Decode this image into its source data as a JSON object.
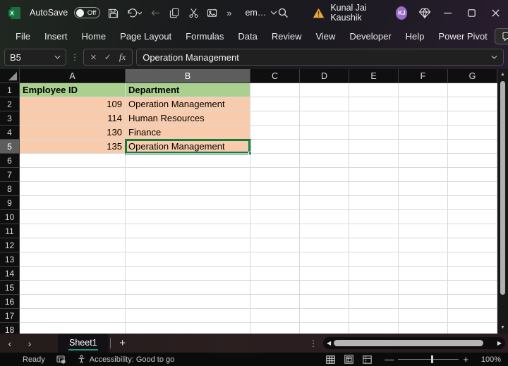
{
  "titlebar": {
    "autosave_label": "AutoSave",
    "autosave_state": "Off",
    "document_name": "em…",
    "user_name": "Kunal Jai Kaushik",
    "user_initials": "KJ"
  },
  "glyphs": {
    "overflow": "»",
    "cancel": "×",
    "enter": "✓",
    "fx": "fx",
    "separator_dots": "⋮",
    "chevron_left": "‹",
    "chevron_right": "›",
    "add": "+",
    "dots_handle": "⋮",
    "scroll_left": "◀",
    "scroll_right": "▶",
    "scroll_up": "▲",
    "scroll_down": "▼",
    "zoom_out": "—",
    "zoom_in": "+"
  },
  "menubar": {
    "tabs": [
      "File",
      "Insert",
      "Home",
      "Page Layout",
      "Formulas",
      "Data",
      "Review",
      "View",
      "Developer",
      "Help",
      "Power Pivot"
    ]
  },
  "formula_bar": {
    "name_box": "B5",
    "formula": "Operation Management"
  },
  "grid": {
    "columns": [
      "A",
      "B",
      "C",
      "D",
      "E",
      "F",
      "G"
    ],
    "row_count": 18,
    "selected_cell": {
      "column": "B",
      "row": 5
    },
    "cells": [
      {
        "ref": "A1",
        "text": "Employee ID",
        "fill": "green",
        "bold": true
      },
      {
        "ref": "B1",
        "text": "Department",
        "fill": "green",
        "bold": true
      },
      {
        "ref": "A2",
        "text": "109",
        "fill": "peach",
        "align": "right"
      },
      {
        "ref": "B2",
        "text": "Operation Management",
        "fill": "peach"
      },
      {
        "ref": "A3",
        "text": "114",
        "fill": "peach",
        "align": "right"
      },
      {
        "ref": "B3",
        "text": "Human Resources",
        "fill": "peach"
      },
      {
        "ref": "A4",
        "text": "130",
        "fill": "peach",
        "align": "right"
      },
      {
        "ref": "B4",
        "text": "Finance",
        "fill": "peach"
      },
      {
        "ref": "A5",
        "text": "135",
        "fill": "peach",
        "align": "right"
      },
      {
        "ref": "B5",
        "text": "Operation Management",
        "fill": "peach"
      }
    ],
    "colors": {
      "header_fill": "#A9D08E",
      "data_fill": "#F8CBAD",
      "selection_border": "#107C41"
    }
  },
  "sheet_tabs": {
    "active_tab": "Sheet1"
  },
  "status_bar": {
    "mode": "Ready",
    "accessibility": "Accessibility: Good to go",
    "zoom_level": "100%"
  }
}
